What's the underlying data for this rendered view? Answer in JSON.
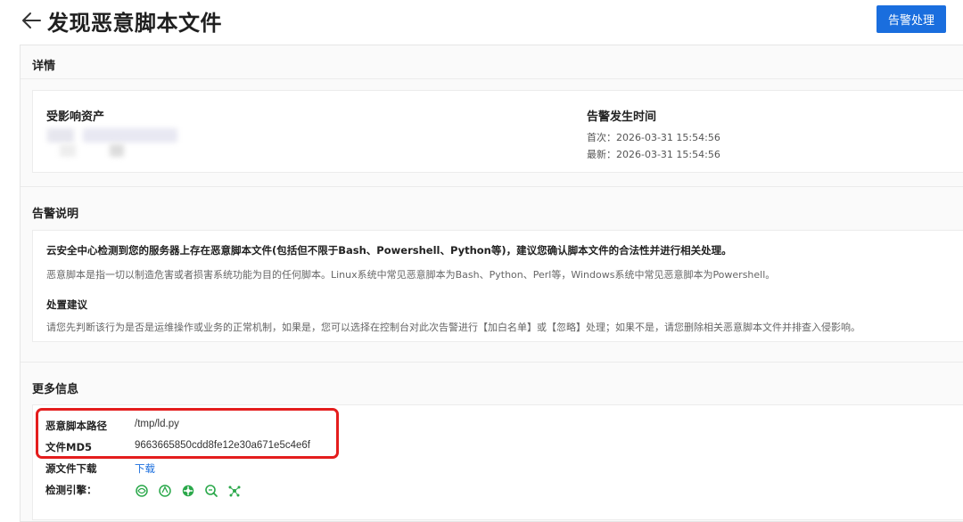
{
  "header": {
    "title": "发现恶意脚本文件",
    "action_button": "告警处理"
  },
  "details": {
    "section_title": "详情",
    "affected_asset_label": "受影响资产",
    "alert_time_label": "告警发生时间",
    "first_seen": "首次：2026-03-31 15:54:56",
    "last_seen": "最新：2026-03-31 15:54:56"
  },
  "alert_description": {
    "section_title": "告警说明",
    "summary": "云安全中心检测到您的服务器上存在恶意脚本文件(包括但不限于Bash、Powershell、Python等)，建议您确认脚本文件的合法性并进行相关处理。",
    "definition": "恶意脚本是指一切以制造危害或者损害系统功能为目的任何脚本。Linux系统中常见恶意脚本为Bash、Python、Perl等，Windows系统中常见恶意脚本为Powershell。",
    "advice_title": "处置建议",
    "advice": "请您先判断该行为是否是运维操作或业务的正常机制，如果是，您可以选择在控制台对此次告警进行【加白名单】或【忽略】处理；如果不是，请您删除相关恶意脚本文件并排查入侵影响。"
  },
  "more_info": {
    "section_title": "更多信息",
    "script_path_label": "恶意脚本路径",
    "script_path": "/tmp/ld.py",
    "md5_label": "文件MD5",
    "md5": "9663665850cdd8fe12e30a671e5c4e6f",
    "download_label": "源文件下载",
    "download_link": "下载",
    "engine_label": "检测引擎：",
    "engine_icons": [
      "engine-1-icon",
      "engine-2-icon",
      "engine-3-icon",
      "engine-4-icon",
      "engine-5-icon"
    ]
  },
  "colors": {
    "primary": "#1a6ede",
    "highlight": "#e41d1d",
    "engine_green": "#2aa84a"
  }
}
